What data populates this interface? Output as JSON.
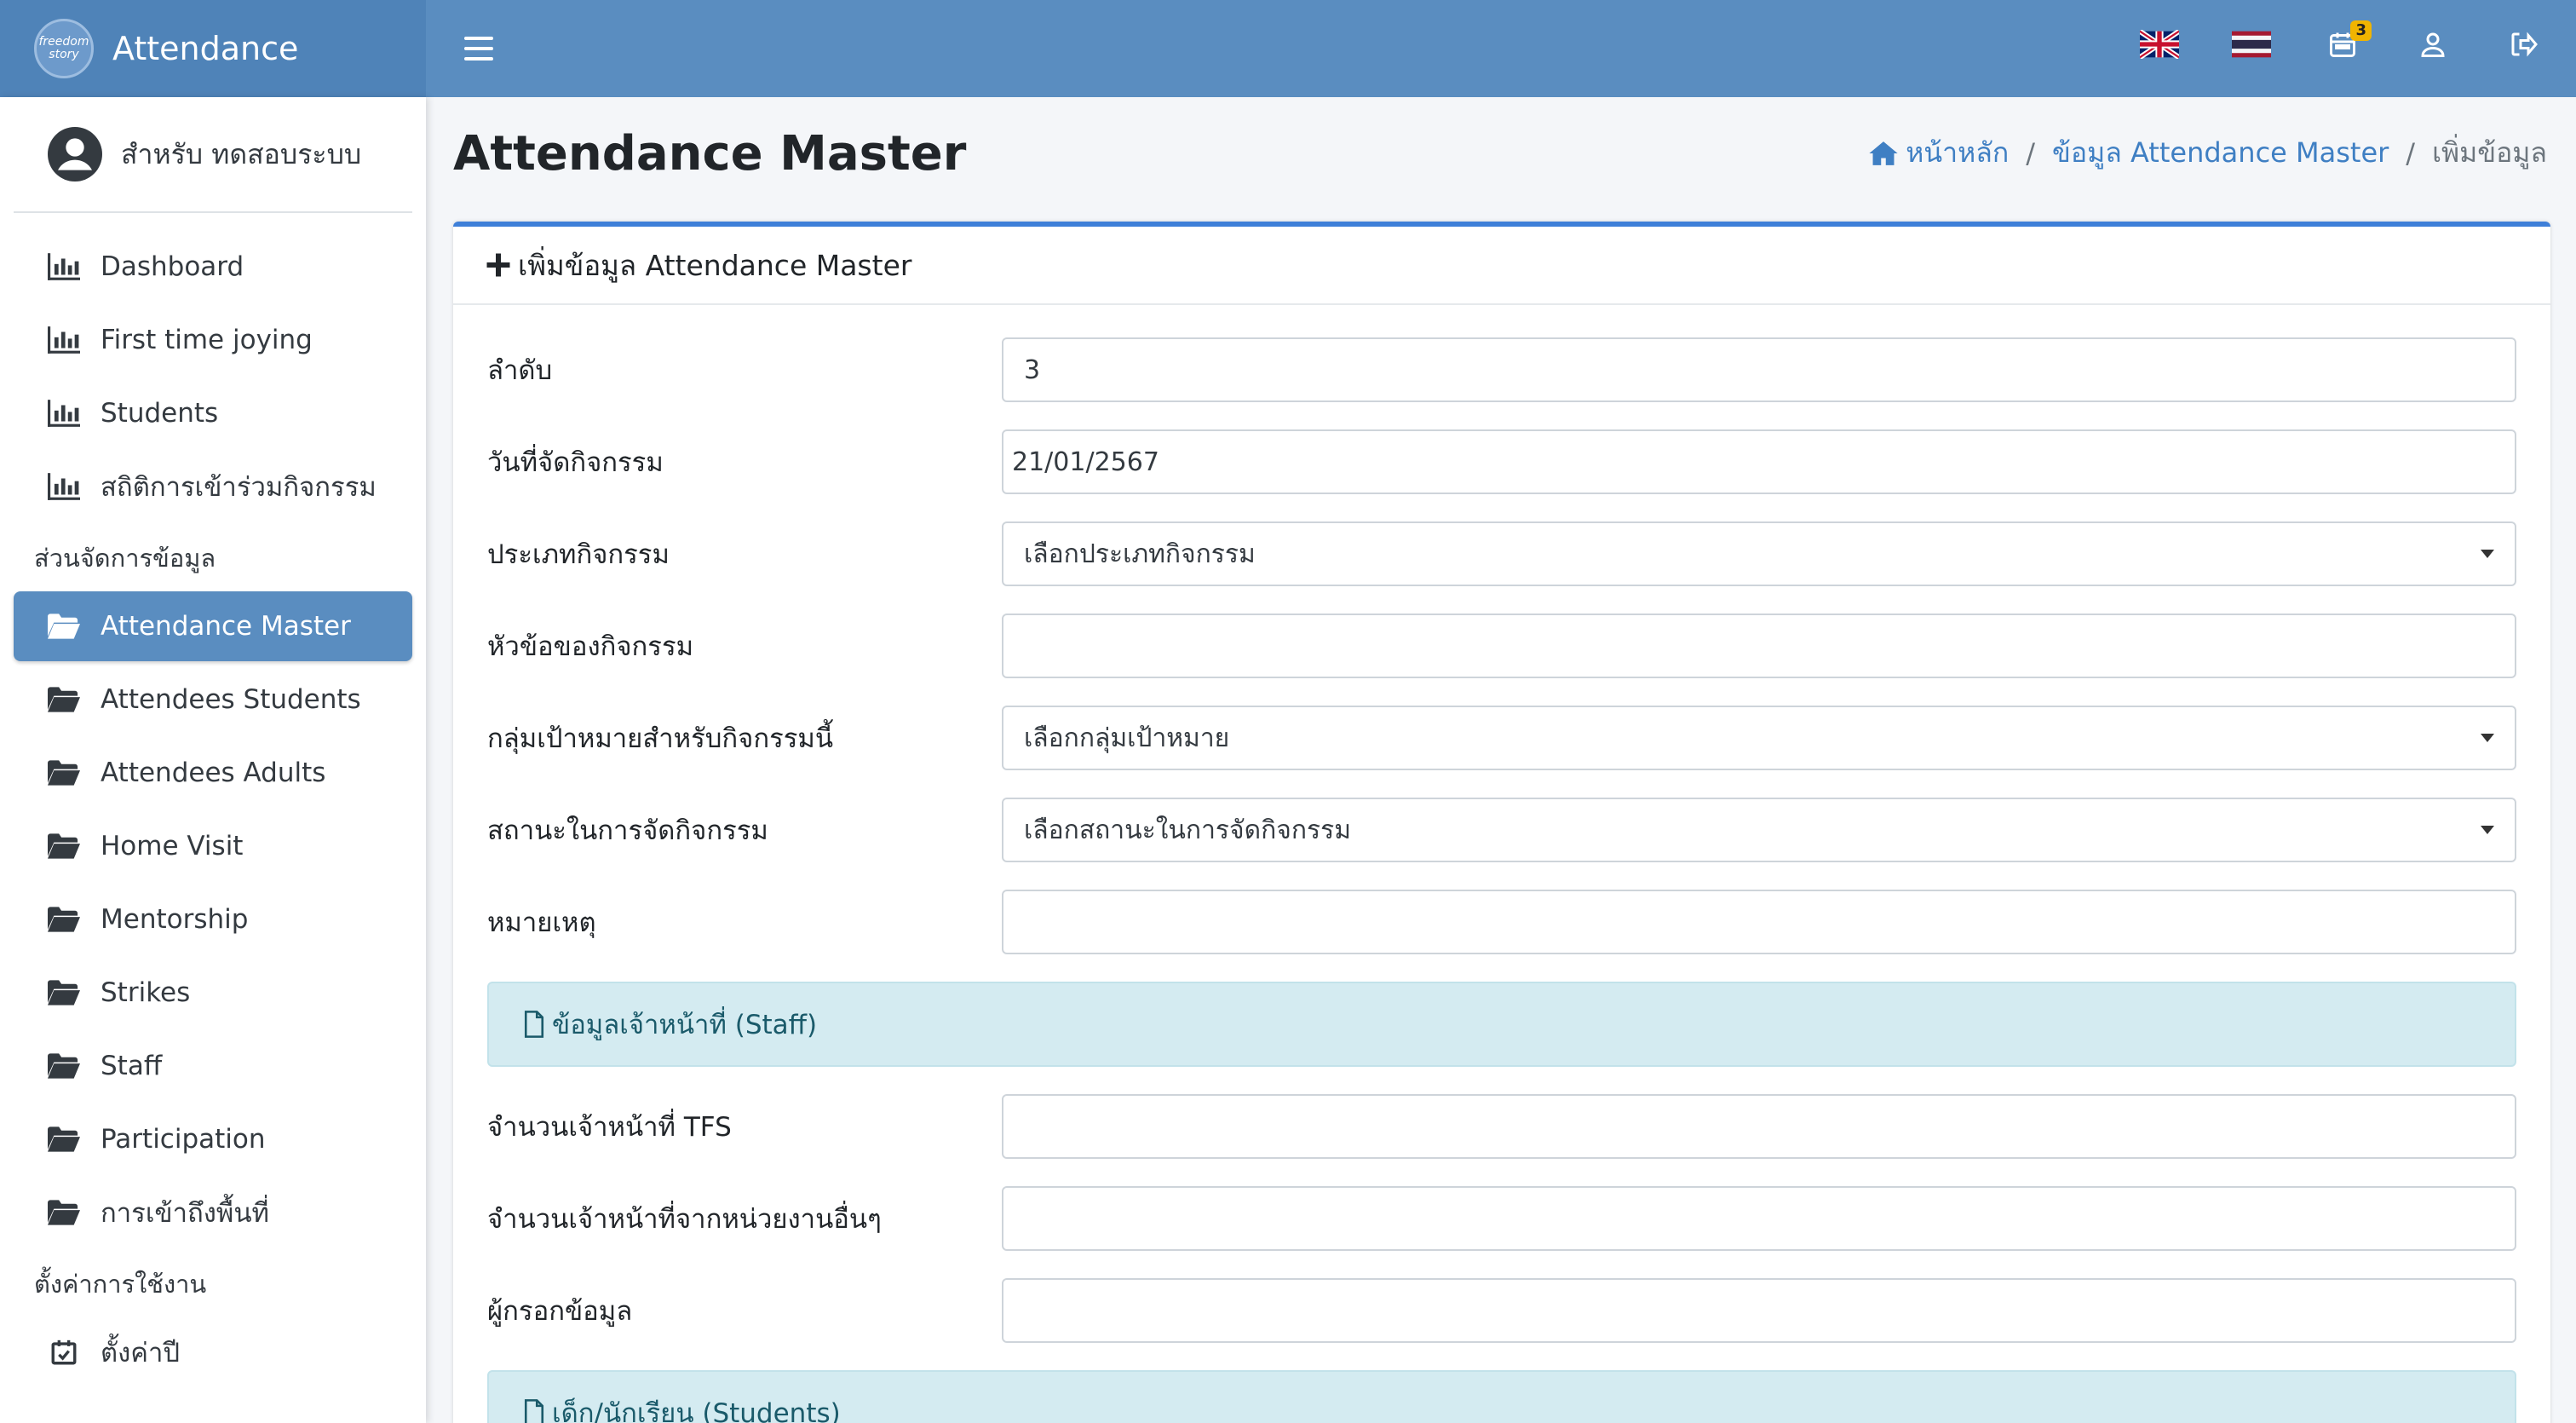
{
  "app": {
    "title": "Attendance",
    "logo_text": "freedom story"
  },
  "topbar": {
    "notifications_count": "3",
    "icons": [
      "menu-icon",
      "uk-flag-icon",
      "thai-flag-icon",
      "calendar-icon",
      "user-icon",
      "logout-icon"
    ]
  },
  "sidebar": {
    "user_name": "สำหรับ ทดสอบระบบ",
    "items": [
      {
        "label": "Dashboard",
        "icon": "bar-chart-icon"
      },
      {
        "label": "First time joying",
        "icon": "bar-chart-icon"
      },
      {
        "label": "Students",
        "icon": "bar-chart-icon"
      },
      {
        "label": "สถิติการเข้าร่วมกิจกรรม",
        "icon": "bar-chart-icon"
      }
    ],
    "section_manage": "ส่วนจัดการข้อมูล",
    "manage_items": [
      {
        "label": "Attendance Master",
        "icon": "folder-open-icon",
        "active": true
      },
      {
        "label": "Attendees Students",
        "icon": "folder-open-icon"
      },
      {
        "label": "Attendees Adults",
        "icon": "folder-open-icon"
      },
      {
        "label": "Home Visit",
        "icon": "folder-open-icon"
      },
      {
        "label": "Mentorship",
        "icon": "folder-open-icon"
      },
      {
        "label": "Strikes",
        "icon": "folder-open-icon"
      },
      {
        "label": "Staff",
        "icon": "folder-open-icon"
      },
      {
        "label": "Participation",
        "icon": "folder-open-icon"
      },
      {
        "label": "การเข้าถึงพื้นที่",
        "icon": "folder-open-icon"
      }
    ],
    "section_settings": "ตั้งค่าการใช้งาน",
    "settings_items": [
      {
        "label": "ตั้งค่าปี",
        "icon": "calendar-check-icon"
      }
    ]
  },
  "page": {
    "title": "Attendance Master",
    "breadcrumb": {
      "home": "หน้าหลัก",
      "section": "ข้อมูล Attendance Master",
      "current": "เพิ่มข้อมูล"
    }
  },
  "form": {
    "header": "เพิ่มข้อมูล Attendance Master",
    "fields": {
      "order": {
        "label": "ลำดับ",
        "value": "3"
      },
      "activity_date": {
        "label": "วันที่จัดกิจกรรม",
        "value": "21/01/2567"
      },
      "activity_type": {
        "label": "ประเภทกิจกรรม",
        "value": "เลือกประเภทกิจกรรม"
      },
      "activity_topic": {
        "label": "หัวข้อของกิจกรรม",
        "value": ""
      },
      "target_group": {
        "label": "กลุ่มเป้าหมายสำหรับกิจกรรมนี้",
        "value": "เลือกกลุ่มเป้าหมาย"
      },
      "location": {
        "label": "สถานะในการจัดกิจกรรม",
        "value": "เลือกสถานะในการจัดกิจกรรม"
      },
      "remarks": {
        "label": "หมายเหตุ",
        "value": ""
      }
    },
    "staff_section": "ข้อมูลเจ้าหน้าที่ (Staff)",
    "staff_fields": {
      "tfs_staff_count": {
        "label": "จำนวนเจ้าหน้าที่ TFS",
        "value": ""
      },
      "other_staff_count": {
        "label": "จำนวนเจ้าหน้าที่จากหน่วยงานอื่นๆ",
        "value": ""
      },
      "recorder": {
        "label": "ผู้กรอกข้อมูล",
        "value": ""
      }
    },
    "students_section": "เด็ก/นักเรียน (Students)"
  },
  "colors": {
    "topbar": "#5a8dc0",
    "brand": "#4f83b8",
    "active_nav": "#5a8dc0",
    "card_top_border": "#3e7fd8",
    "info_section_bg": "#d4ebf1",
    "badge": "#f0b400"
  }
}
